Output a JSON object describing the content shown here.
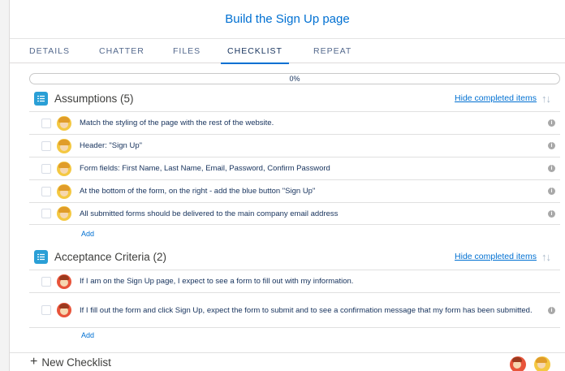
{
  "header": {
    "title": "Build the Sign Up page"
  },
  "tabs": [
    {
      "label": "DETAILS"
    },
    {
      "label": "CHATTER"
    },
    {
      "label": "FILES"
    },
    {
      "label": "CHECKLIST"
    },
    {
      "label": "REPEAT"
    }
  ],
  "progress": {
    "text": "0%",
    "value": 0
  },
  "assumptions": {
    "title": "Assumptions (5)",
    "hide_label": "Hide completed items",
    "items": [
      {
        "text": "Match the styling of the page with the rest of the website."
      },
      {
        "text": "Header: \"Sign Up\""
      },
      {
        "text": "Form fields: First Name, Last Name, Email, Password, Confirm Password"
      },
      {
        "text": "At the bottom of the form, on the right - add the blue button \"Sign Up\""
      },
      {
        "text": "All submitted forms should be delivered to the main company email address"
      }
    ],
    "add_label": "Add"
  },
  "acceptance": {
    "title": "Acceptance Criteria (2)",
    "hide_label": "Hide completed items",
    "items": [
      {
        "text": "If I am on the Sign Up page, I expect to see a form to fill out with my information."
      },
      {
        "text": "If I fill out the form and click Sign Up, expect the form to submit and to see a confirmation message that my form has been submitted."
      }
    ],
    "add_label": "Add"
  },
  "footer": {
    "new_checklist_label": "New Checklist"
  },
  "colors": {
    "accent": "#0070d2",
    "section_icon": "#2a9fd6"
  }
}
